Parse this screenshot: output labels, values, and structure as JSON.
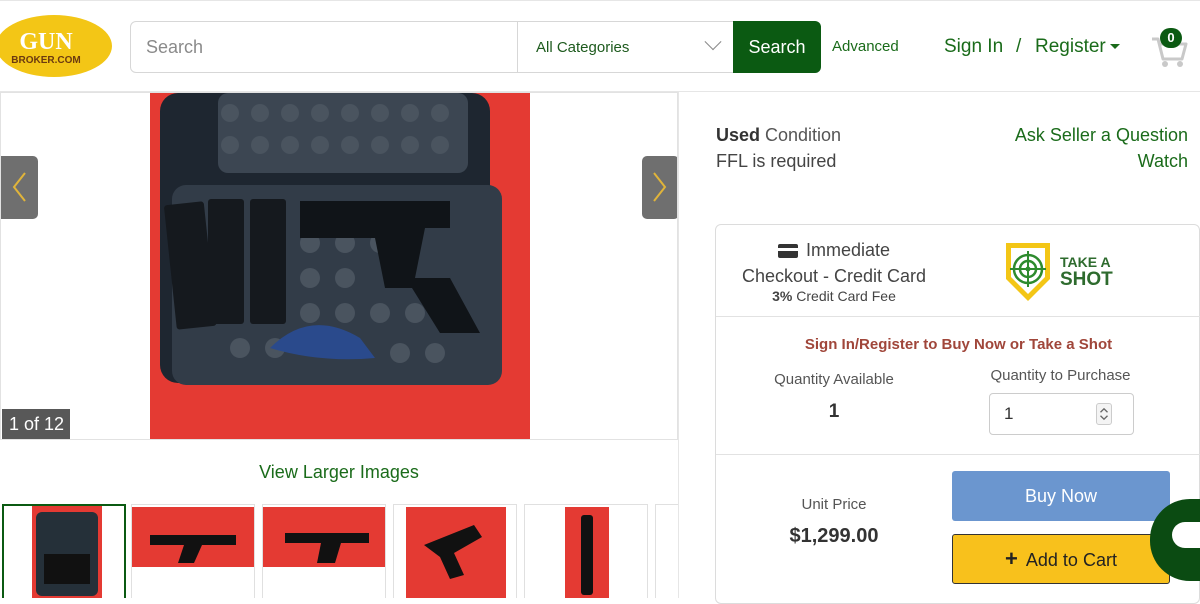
{
  "header": {
    "logo_top": "GUN",
    "logo_bottom": "BROKER.COM",
    "search_placeholder": "Search",
    "category": "All Categories",
    "search_button": "Search",
    "advanced": "Advanced",
    "sign_in": "Sign In",
    "separator": "/",
    "register": "Register",
    "cart_count": "0"
  },
  "gallery": {
    "counter": "1 of 12",
    "view_larger": "View Larger Images",
    "thumbnail_count": 6
  },
  "listing": {
    "condition_bold": "Used",
    "condition_rest": " Condition",
    "ffl": "FFL is required",
    "ask_seller": "Ask Seller a Question",
    "watch": "Watch"
  },
  "buybox": {
    "checkout_line1": "Immediate",
    "checkout_line2": "Checkout - Credit Card",
    "fee_percent": "3%",
    "fee_rest": " Credit Card Fee",
    "tas_line1": "TAKE A",
    "tas_line2": "SHOT",
    "prompt": "Sign In/Register to Buy Now or Take a Shot",
    "qty_available_label": "Quantity Available",
    "qty_available": "1",
    "qty_purchase_label": "Quantity to Purchase",
    "qty_purchase": "1",
    "unit_price_label": "Unit Price",
    "unit_price": "$1,299.00",
    "buy_now": "Buy Now",
    "add_to_cart": "Add to Cart"
  },
  "colors": {
    "brand_green": "#0b5a12",
    "logo_yellow": "#f3c616",
    "buy_now_blue": "#6b96cf",
    "cart_yellow": "#f8c11c",
    "prompt_red": "#a0463a"
  }
}
